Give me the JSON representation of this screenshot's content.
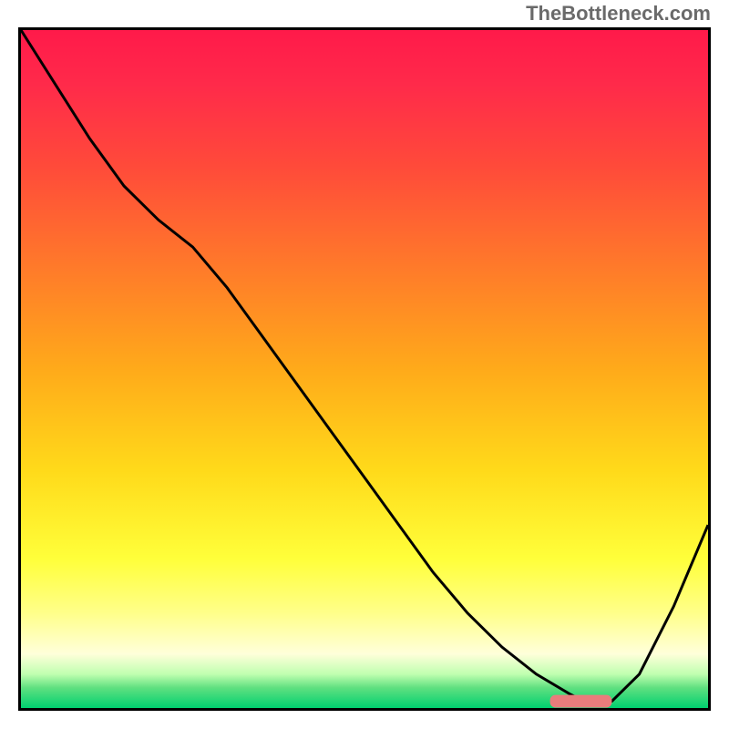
{
  "watermark": "TheBottleneck.com",
  "chart_data": {
    "type": "line",
    "title": "",
    "xlabel": "",
    "ylabel": "",
    "xlim": [
      0,
      100
    ],
    "ylim": [
      0,
      100
    ],
    "x": [
      0,
      5,
      10,
      15,
      20,
      25,
      30,
      35,
      40,
      45,
      50,
      55,
      60,
      65,
      70,
      75,
      80,
      82,
      84,
      86,
      90,
      95,
      100
    ],
    "y": [
      100,
      92,
      84,
      77,
      72,
      68,
      62,
      55,
      48,
      41,
      34,
      27,
      20,
      14,
      9,
      5,
      2,
      1,
      1,
      1,
      5,
      15,
      27
    ],
    "marker": {
      "x_range": [
        77,
        86
      ],
      "y": 1
    },
    "gradient_stops": [
      {
        "pos": 0,
        "color": "#ff1a4a"
      },
      {
        "pos": 20,
        "color": "#ff4a3a"
      },
      {
        "pos": 50,
        "color": "#ffaa1a"
      },
      {
        "pos": 78,
        "color": "#ffff3a"
      },
      {
        "pos": 95,
        "color": "#c0ffb0"
      },
      {
        "pos": 100,
        "color": "#00d070"
      }
    ]
  }
}
